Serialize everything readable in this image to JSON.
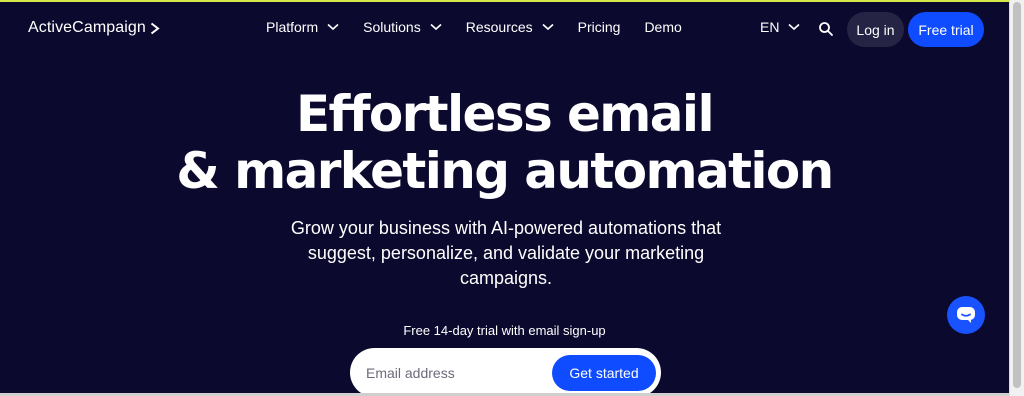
{
  "header": {
    "logo_text": "ActiveCampaign",
    "nav": [
      {
        "label": "Platform"
      },
      {
        "label": "Solutions"
      },
      {
        "label": "Resources"
      },
      {
        "label": "Pricing"
      },
      {
        "label": "Demo"
      }
    ],
    "language": "EN",
    "login_label": "Log in",
    "trial_label": "Free trial"
  },
  "hero": {
    "title_line1": "Effortless email",
    "title_line2": "& marketing automation",
    "subtitle": "Grow your business with AI-powered automations that suggest, personalize, and validate your marketing campaigns.",
    "trial_note": "Free 14-day trial with email sign-up",
    "email_placeholder": "Email address",
    "cta_label": "Get started"
  },
  "icons": {
    "logo_arrow": "chevron-right-icon",
    "nav_dropdown": "chevron-down-icon",
    "search": "search-icon",
    "chat": "chat-icon"
  },
  "colors": {
    "background": "#0b0a2e",
    "accent": "#0f4cff",
    "top_line": "#d6e84a"
  }
}
